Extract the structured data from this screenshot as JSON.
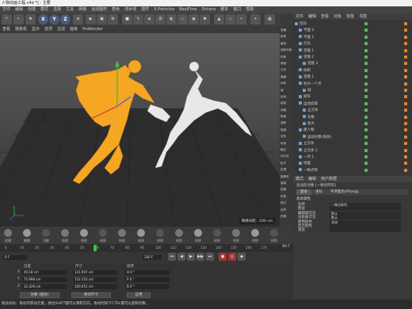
{
  "app": {
    "title": "人物动画工程.c4d *] - 主要"
  },
  "menu": [
    "文件",
    "编辑",
    "创建",
    "模式",
    "选择",
    "工具",
    "网格",
    "运动图形",
    "角色",
    "流水线",
    "插件",
    "X-Particles",
    "RealFlow",
    "Octane",
    "脚本",
    "窗口",
    "帮助"
  ],
  "toolbar": {
    "buttons": [
      "X",
      "Y",
      "Z"
    ]
  },
  "viewport": {
    "header": [
      "查看",
      "摄像机",
      "显示",
      "选项",
      "过滤",
      "面板",
      "ProRender"
    ],
    "grid_readout": "网格间距 : 100 cm",
    "colors": {
      "figure_orange": "#f5a623",
      "figure_white": "#e8e8e8",
      "background": "#4d4d4d"
    }
  },
  "context_panel": {
    "items": [
      "克隆",
      "矩阵",
      "破碎",
      "追踪对象",
      "样条",
      "简易",
      "文本",
      "晶格",
      "体积",
      "域",
      "运动",
      "绘制",
      "体素",
      "群组",
      "追踪",
      "碰撞",
      "变形",
      "时间",
      "融合",
      "动力学",
      "粒子",
      "纹理",
      "摄像机",
      "渲染",
      "效果",
      "材质",
      "域力",
      "对齐",
      "资源"
    ]
  },
  "object_manager": {
    "menu": [
      "文件",
      "编辑",
      "查看",
      "对象",
      "标签",
      "书签"
    ],
    "rows": [
      {
        "name": "空白",
        "indent": 0
      },
      {
        "name": "平面 2",
        "indent": 1
      },
      {
        "name": "平面 1",
        "indent": 1
      },
      {
        "name": "灯光",
        "indent": 1
      },
      {
        "name": "克隆 1",
        "indent": 1
      },
      {
        "name": "克隆 2",
        "indent": 1
      },
      {
        "name": "克隆 3",
        "indent": 2
      },
      {
        "name": "体积",
        "indent": 1
      },
      {
        "name": "克隆 1",
        "indent": 1
      },
      {
        "name": "另外一个点",
        "indent": 1
      },
      {
        "name": "域",
        "indent": 2
      },
      {
        "name": "矩阵",
        "indent": 1
      },
      {
        "name": "运动剪辑",
        "indent": 1
      },
      {
        "name": "立方体",
        "indent": 2
      },
      {
        "name": "对象",
        "indent": 2
      },
      {
        "name": "放大",
        "indent": 2
      },
      {
        "name": "建人物",
        "indent": 1
      },
      {
        "name": "运动对象(角色)",
        "indent": 2
      },
      {
        "name": "立方体",
        "indent": 1
      },
      {
        "name": "立方体.1",
        "indent": 1
      },
      {
        "name": "一对 1",
        "indent": 1
      },
      {
        "name": "地面",
        "indent": 1
      },
      {
        "name": "一物点阵",
        "indent": 1
      }
    ]
  },
  "attributes": {
    "tabs": [
      "模式",
      "编辑",
      "用户数据"
    ],
    "object_title": "多边形对象 [一物点阵列]",
    "subtabs": [
      "基本",
      "坐标",
      "平滑着色(Phong)"
    ],
    "section": "基本属性",
    "fields": [
      {
        "label": "名称",
        "value": "一物点阵列"
      },
      {
        "label": "图层",
        "value": ""
      },
      {
        "label": "编辑器可见",
        "value": "默认"
      },
      {
        "label": "渲染器可见",
        "value": "默认"
      },
      {
        "label": "使用颜色",
        "value": "关闭"
      },
      {
        "label": "显示颜色",
        "value": ""
      },
      {
        "label": "透显",
        "value": ""
      }
    ]
  },
  "mat_bar": {
    "items": [
      "创建",
      "编辑",
      "功能",
      "纹理",
      "材质",
      "材质",
      "材质",
      "材质",
      "材质",
      "材质",
      "材质",
      "材质",
      "材质",
      "材质",
      "材质"
    ]
  },
  "timeline": {
    "ticks": [
      "0",
      "10",
      "20",
      "30",
      "40",
      "50",
      "60",
      "70",
      "80",
      "90",
      "100",
      "110",
      "120",
      "130",
      "140",
      "150",
      "160",
      "170"
    ],
    "current_frame": "90 F"
  },
  "transport": {
    "start": "0 F",
    "end": "200 F"
  },
  "coords": {
    "headers": [
      "位置",
      "尺寸",
      "旋转"
    ],
    "rows": [
      {
        "axis": "X",
        "pos": "40.18 cm",
        "size": "141.907 cm",
        "rot": "H 0 °"
      },
      {
        "axis": "Y",
        "pos": "75.998 cm",
        "size": "152.253 cm",
        "rot": "P 0 °"
      },
      {
        "axis": "Z",
        "pos": "32.426 cm",
        "size": "100.651 cm",
        "rot": "B 0 °"
      }
    ],
    "mode_left": "对象 (相对)",
    "mode_right": "绝对尺寸",
    "apply": "应用"
  },
  "statusbar": {
    "text": "拖动光标：拖动可移动元素，按住SHIFT键可以限制方向。拖动时按下CTRL键可以复制对象。"
  }
}
